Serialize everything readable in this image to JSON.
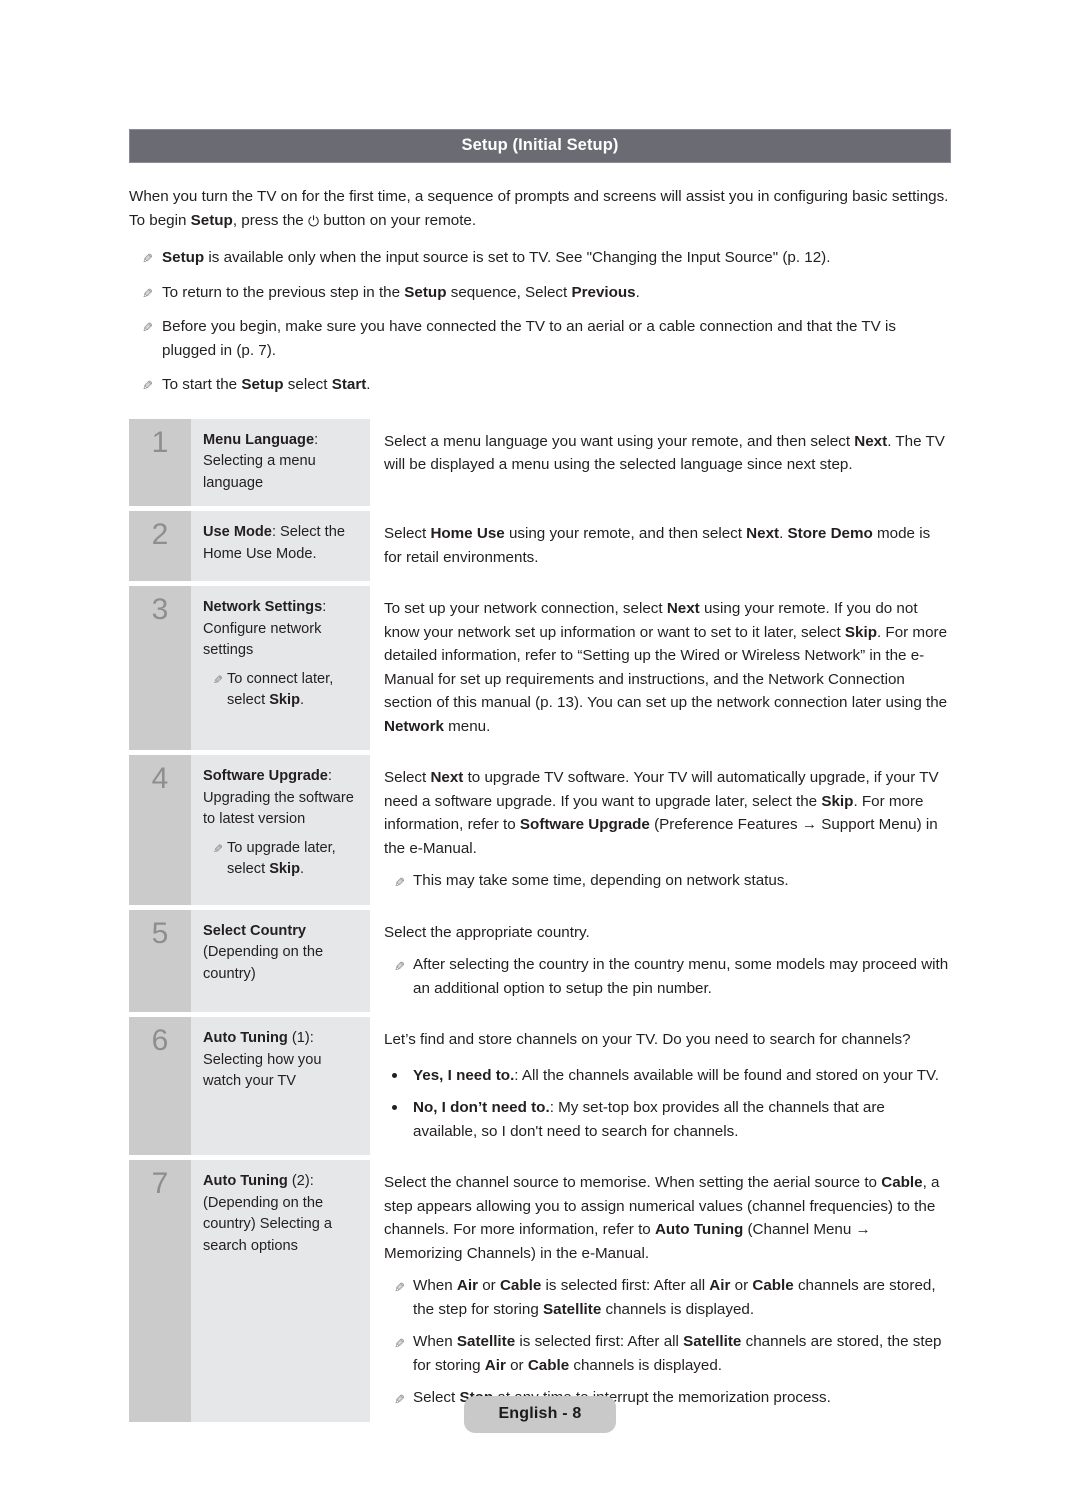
{
  "section": {
    "title": "Setup (Initial Setup)"
  },
  "intro": {
    "part1": "When you turn the TV on for the first time, a sequence of prompts and screens will assist you in configuring basic settings. To begin ",
    "bold1": "Setup",
    "part2": ", press the ",
    "power_icon": "⏻",
    "part3": " button on your remote."
  },
  "notes": [
    {
      "icon": "pencil-note-icon",
      "segments": [
        {
          "text": "Setup",
          "bold": true
        },
        {
          "text": " is available only when the input source is set to TV. See \"Changing the Input Source\" (p. 12).",
          "bold": false
        }
      ]
    },
    {
      "icon": "pencil-note-icon",
      "segments": [
        {
          "text": "To return to the previous step in the ",
          "bold": false
        },
        {
          "text": "Setup",
          "bold": true
        },
        {
          "text": " sequence, Select ",
          "bold": false
        },
        {
          "text": "Previous",
          "bold": true
        },
        {
          "text": ".",
          "bold": false
        }
      ]
    },
    {
      "icon": "pencil-note-icon",
      "segments": [
        {
          "text": "Before you begin, make sure you have connected the TV to an aerial or a cable connection and that the TV is plugged in (p. 7).",
          "bold": false
        }
      ]
    },
    {
      "icon": "pencil-note-icon",
      "segments": [
        {
          "text": "To start the ",
          "bold": false
        },
        {
          "text": "Setup",
          "bold": true
        },
        {
          "text": " select ",
          "bold": false
        },
        {
          "text": "Start",
          "bold": true
        },
        {
          "text": ".",
          "bold": false
        }
      ]
    }
  ],
  "colors": {
    "section_bar": "#6b6b73",
    "number_cell": "#cbcbcb",
    "title_cell": "#e6e7e8",
    "number_text": "#8e8e8e",
    "body_text": "#231f20",
    "footer_pill": "#c9c9c9"
  },
  "steps": [
    {
      "number": "1",
      "title_segments": [
        {
          "text": "Menu Language",
          "bold": true
        },
        {
          "text": ":",
          "bold": false
        },
        {
          "text": " Selecting a menu language",
          "bold": false
        }
      ],
      "title_notes": [],
      "paragraphs": [
        [
          {
            "text": "Select a menu language you want using your remote, and then select ",
            "bold": false
          },
          {
            "text": "Next",
            "bold": true
          },
          {
            "text": ". The TV will be displayed a menu using the selected language since next step.",
            "bold": false
          }
        ]
      ],
      "desc_notes": [],
      "dots": []
    },
    {
      "number": "2",
      "title_segments": [
        {
          "text": "Use Mode",
          "bold": true
        },
        {
          "text": ": Select the Home Use Mode.",
          "bold": false
        }
      ],
      "title_notes": [],
      "paragraphs": [
        [
          {
            "text": "Select ",
            "bold": false
          },
          {
            "text": "Home Use",
            "bold": true
          },
          {
            "text": " using your remote, and then select ",
            "bold": false
          },
          {
            "text": "Next",
            "bold": true
          },
          {
            "text": ". ",
            "bold": false
          },
          {
            "text": "Store Demo",
            "bold": true
          },
          {
            "text": " mode is for retail environments.",
            "bold": false
          }
        ]
      ],
      "desc_notes": [],
      "dots": []
    },
    {
      "number": "3",
      "title_segments": [
        {
          "text": "Network Settings",
          "bold": true
        },
        {
          "text": ": Configure network settings",
          "bold": false
        }
      ],
      "title_notes": [
        {
          "icon": "pencil-note-icon",
          "segments": [
            {
              "text": "To connect later, select ",
              "bold": false
            },
            {
              "text": "Skip",
              "bold": true
            },
            {
              "text": ".",
              "bold": false
            }
          ]
        }
      ],
      "paragraphs": [
        [
          {
            "text": "To set up your network connection, select ",
            "bold": false
          },
          {
            "text": "Next",
            "bold": true
          },
          {
            "text": " using your remote. If you do not know your network set up information or want to set to it later, select ",
            "bold": false
          },
          {
            "text": "Skip",
            "bold": true
          },
          {
            "text": ". For more detailed information, refer to “Setting up the Wired or Wireless Network” in the e-Manual for set up requirements and instructions, and the Network Connection section of this manual (p. 13). You can set up the network connection later using the ",
            "bold": false
          },
          {
            "text": "Network",
            "bold": true
          },
          {
            "text": " menu.",
            "bold": false
          }
        ]
      ],
      "desc_notes": [],
      "dots": []
    },
    {
      "number": "4",
      "title_segments": [
        {
          "text": "Software Upgrade",
          "bold": true
        },
        {
          "text": ": Upgrading the software to latest version",
          "bold": false
        }
      ],
      "title_notes": [
        {
          "icon": "pencil-note-icon",
          "segments": [
            {
              "text": "To upgrade later, select ",
              "bold": false
            },
            {
              "text": "Skip",
              "bold": true
            },
            {
              "text": ".",
              "bold": false
            }
          ]
        }
      ],
      "paragraphs": [
        [
          {
            "text": "Select ",
            "bold": false
          },
          {
            "text": "Next",
            "bold": true
          },
          {
            "text": " to upgrade TV software. Your TV will automatically upgrade, if your TV need a software upgrade. If you want to upgrade later, select the ",
            "bold": false
          },
          {
            "text": "Skip",
            "bold": true
          },
          {
            "text": ". For more information, refer to ",
            "bold": false
          },
          {
            "text": "Software Upgrade",
            "bold": true
          },
          {
            "text": " (Preference Features → Support Menu) in the e-Manual.",
            "bold": false
          }
        ]
      ],
      "desc_notes": [
        {
          "icon": "pencil-note-icon",
          "segments": [
            {
              "text": "This may take some time, depending on network status.",
              "bold": false
            }
          ]
        }
      ],
      "dots": []
    },
    {
      "number": "5",
      "title_segments": [
        {
          "text": "Select Country",
          "bold": true
        },
        {
          "text": " (Depending on the country)",
          "bold": false
        }
      ],
      "title_notes": [],
      "paragraphs": [
        [
          {
            "text": "Select the appropriate country.",
            "bold": false
          }
        ]
      ],
      "desc_notes": [
        {
          "icon": "pencil-note-icon",
          "segments": [
            {
              "text": "After selecting the country in the country menu, some models may proceed with an additional option to setup the pin number.",
              "bold": false
            }
          ]
        }
      ],
      "dots": []
    },
    {
      "number": "6",
      "title_segments": [
        {
          "text": "Auto Tuning",
          "bold": true
        },
        {
          "text": " (1): Selecting how you watch your TV",
          "bold": false
        }
      ],
      "title_notes": [],
      "paragraphs": [
        [
          {
            "text": "Let’s find and store channels on your TV. Do you need to search for channels?",
            "bold": false
          }
        ]
      ],
      "desc_notes": [],
      "dots": [
        {
          "segments": [
            {
              "text": "Yes, I need to.",
              "bold": true
            },
            {
              "text": ": All the channels available will be found and stored on your TV.",
              "bold": false
            }
          ]
        },
        {
          "segments": [
            {
              "text": "No, I don’t need to.",
              "bold": true
            },
            {
              "text": ": My set-top box provides all the channels that are available, so I don't need to search for channels.",
              "bold": false
            }
          ]
        }
      ]
    },
    {
      "number": "7",
      "title_segments": [
        {
          "text": "Auto Tuning",
          "bold": true
        },
        {
          "text": " (2): (Depending on the country) Selecting a search options",
          "bold": false
        }
      ],
      "title_notes": [],
      "paragraphs": [
        [
          {
            "text": "Select the channel source to memorise. When setting the aerial source to ",
            "bold": false
          },
          {
            "text": "Cable",
            "bold": true
          },
          {
            "text": ", a step appears allowing you to assign numerical values (channel frequencies) to the channels. For more information, refer to ",
            "bold": false
          },
          {
            "text": "Auto Tuning",
            "bold": true
          },
          {
            "text": " (Channel Menu → Memorizing Channels) in the e-Manual.",
            "bold": false
          }
        ]
      ],
      "desc_notes": [
        {
          "icon": "pencil-note-icon",
          "segments": [
            {
              "text": "When ",
              "bold": false
            },
            {
              "text": "Air",
              "bold": true
            },
            {
              "text": " or ",
              "bold": false
            },
            {
              "text": "Cable",
              "bold": true
            },
            {
              "text": " is selected first: After all ",
              "bold": false
            },
            {
              "text": "Air",
              "bold": true
            },
            {
              "text": " or ",
              "bold": false
            },
            {
              "text": "Cable",
              "bold": true
            },
            {
              "text": " channels are stored, the step for storing ",
              "bold": false
            },
            {
              "text": "Satellite",
              "bold": true
            },
            {
              "text": " channels is displayed.",
              "bold": false
            }
          ]
        },
        {
          "icon": "pencil-note-icon",
          "segments": [
            {
              "text": "When ",
              "bold": false
            },
            {
              "text": "Satellite",
              "bold": true
            },
            {
              "text": " is selected first: After all ",
              "bold": false
            },
            {
              "text": "Satellite",
              "bold": true
            },
            {
              "text": " channels are stored, the step for storing ",
              "bold": false
            },
            {
              "text": "Air",
              "bold": true
            },
            {
              "text": " or ",
              "bold": false
            },
            {
              "text": "Cable",
              "bold": true
            },
            {
              "text": " channels is displayed.",
              "bold": false
            }
          ]
        },
        {
          "icon": "pencil-note-icon",
          "segments": [
            {
              "text": "Select ",
              "bold": false
            },
            {
              "text": "Stop",
              "bold": true
            },
            {
              "text": " at any time to interrupt the memorization process.",
              "bold": false
            }
          ]
        }
      ],
      "dots": []
    }
  ],
  "footer": {
    "label": "English - 8"
  }
}
